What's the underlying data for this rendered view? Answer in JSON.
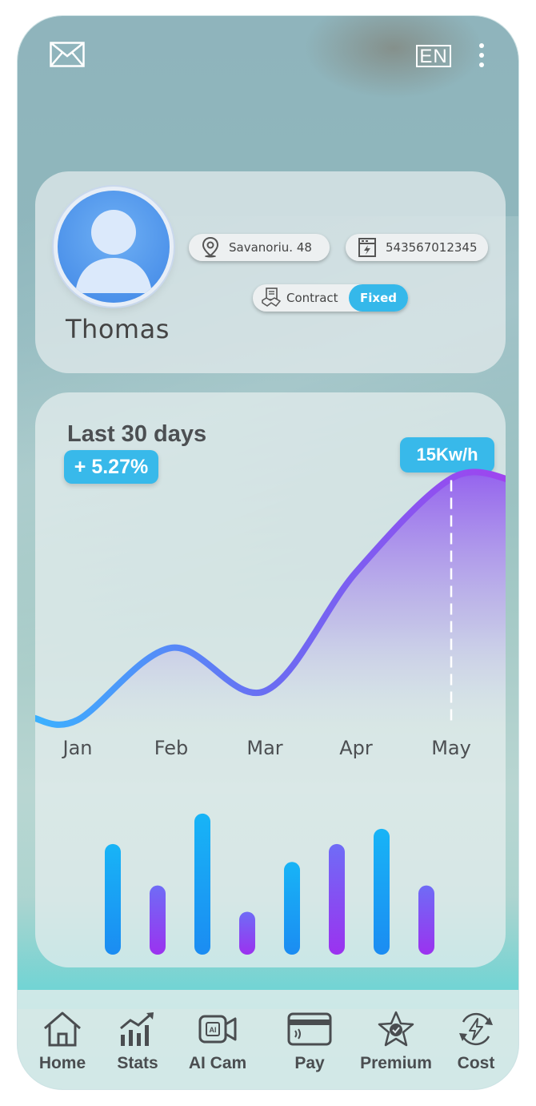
{
  "top_bar": {
    "mail_icon": "envelope-icon",
    "language": "EN",
    "menu_icon": "vertical-dots-icon"
  },
  "profile": {
    "name": "Thomas",
    "address": "Savanoriu. 48",
    "meter_id": "543567012345",
    "contract_label": "Contract",
    "contract_type": "Fixed"
  },
  "stats": {
    "period_title": "Last 30 days",
    "change": "+ 5.27%",
    "highlight_value": "15Kw/h"
  },
  "chart_data": [
    {
      "type": "area",
      "title": "",
      "categories": [
        "Jan",
        "Feb",
        "Mar",
        "Apr",
        "May"
      ],
      "values": [
        1.6,
        5.6,
        3.2,
        9.8,
        15
      ],
      "ylim": [
        0,
        16
      ],
      "highlight_category": "May",
      "highlight_label": "15Kw/h",
      "grid": false,
      "colors": [
        "#3ab2ff",
        "#6b6cf2",
        "#a043ef"
      ]
    },
    {
      "type": "bar",
      "title": "",
      "values": [
        8,
        5,
        10.2,
        3.1,
        6.7,
        8,
        9.1,
        5
      ],
      "ylim": [
        0,
        11
      ],
      "grid": false,
      "colors": [
        "#1aa7f5",
        "#8b3cf0"
      ]
    }
  ],
  "bottom_nav": [
    {
      "label": "Home",
      "icon": "home-icon"
    },
    {
      "label": "Stats",
      "icon": "stats-icon"
    },
    {
      "label": "AI Cam",
      "icon": "ai-camera-icon"
    },
    {
      "label": "Pay",
      "icon": "payment-card-icon"
    },
    {
      "label": "Premium",
      "icon": "premium-star-icon"
    },
    {
      "label": "Cost",
      "icon": "cost-cycle-icon"
    }
  ]
}
